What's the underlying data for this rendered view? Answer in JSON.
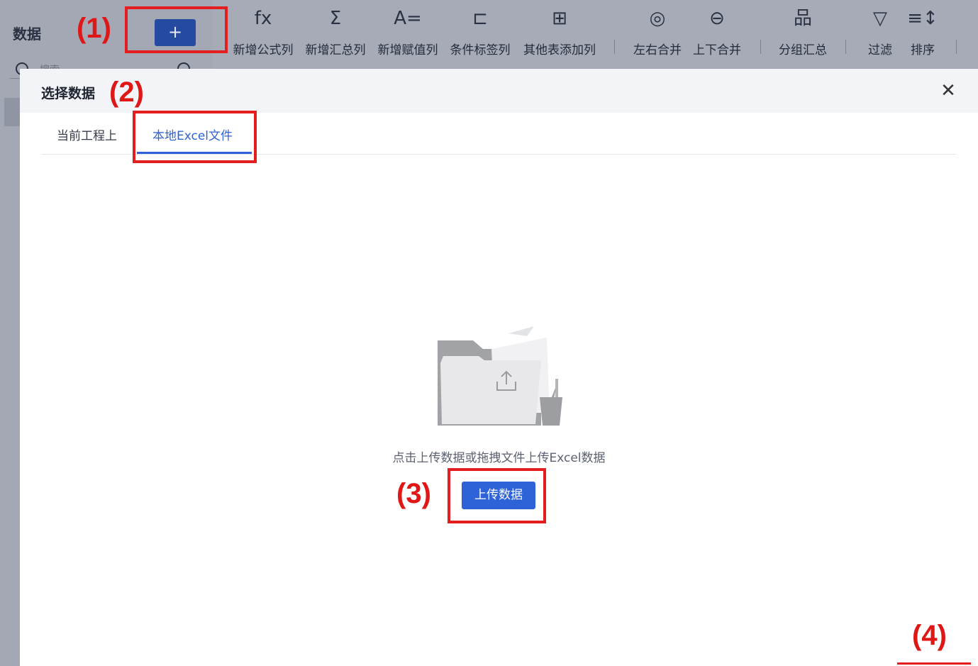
{
  "app": {
    "title": "数据",
    "add_button_label": "+",
    "search_placeholder": "搜索"
  },
  "toolbar": {
    "items": [
      {
        "icon": "fx",
        "label": "新增公式列"
      },
      {
        "icon": "Σ",
        "label": "新增汇总列"
      },
      {
        "icon": "A=",
        "label": "新增赋值列"
      },
      {
        "icon": "⊏",
        "label": "条件标签列"
      },
      {
        "icon": "⊞",
        "label": "其他表添加列"
      },
      {
        "icon": "◎",
        "label": "左右合并"
      },
      {
        "icon": "⊖",
        "label": "上下合并"
      },
      {
        "icon": "品",
        "label": "分组汇总"
      },
      {
        "icon": "▽",
        "label": "过滤"
      },
      {
        "icon": "≡↕",
        "label": "排序"
      }
    ]
  },
  "modal": {
    "title": "选择数据",
    "close_label": "✕",
    "tabs": [
      {
        "label": "当前工程上"
      },
      {
        "label": "本地Excel文件"
      }
    ],
    "upload_hint": "点击上传数据或拖拽文件上传Excel数据",
    "upload_button": "上传数据"
  },
  "annotations": [
    "(1)",
    "(2)",
    "(3)",
    "(4)"
  ],
  "colors": {
    "accent": "#2e62d9",
    "annotation": "#e41e1e",
    "overlay": "#9fa4b2"
  }
}
